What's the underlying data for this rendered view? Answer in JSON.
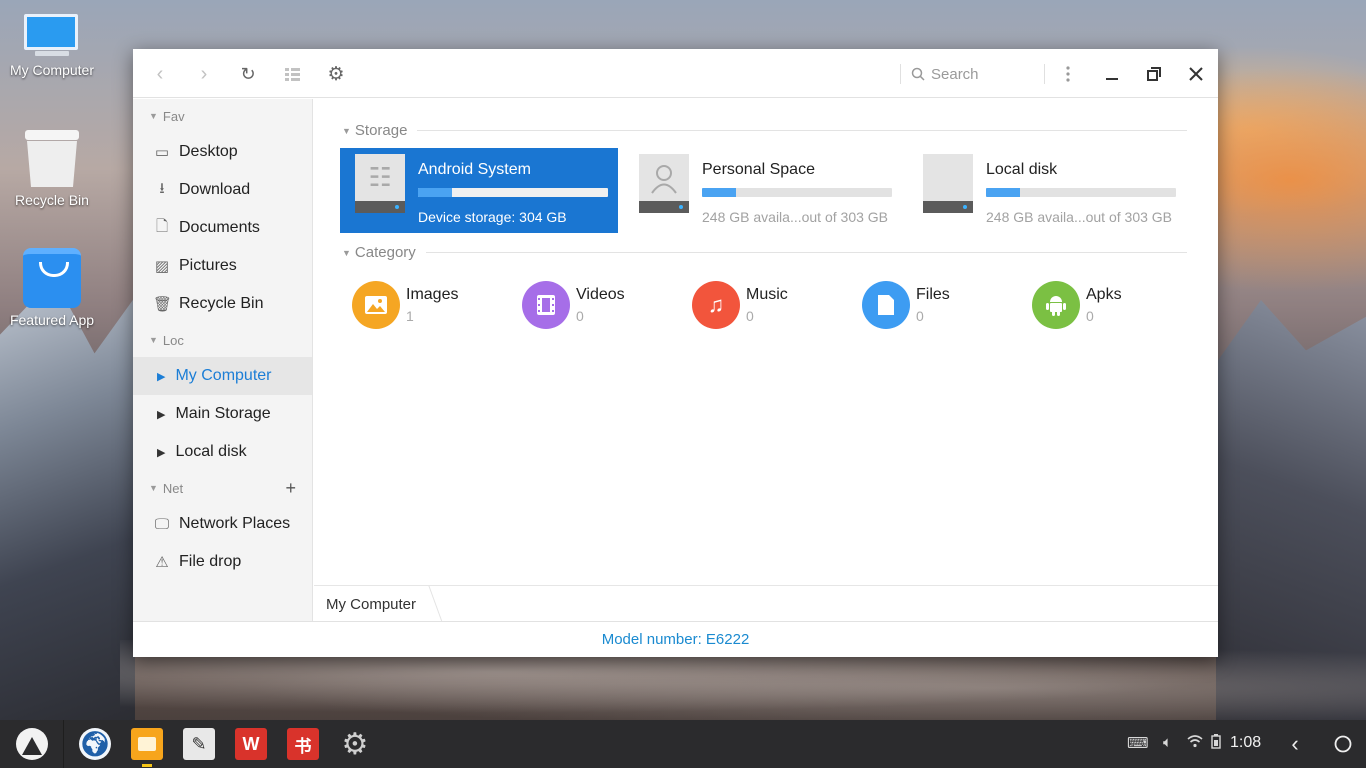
{
  "desktop": {
    "icons": [
      {
        "label": "My Computer"
      },
      {
        "label": "Recycle Bin"
      },
      {
        "label": "Featured App"
      }
    ]
  },
  "window": {
    "toolbar": {
      "back_icon": "chevron-left-icon",
      "forward_icon": "chevron-right-icon",
      "refresh_icon": "refresh-icon",
      "view_icon": "grid-view-icon",
      "settings_icon": "gear-icon",
      "search_placeholder": "Search",
      "more_icon": "more-vertical-icon",
      "minimize_icon": "minimize-icon",
      "maximize_icon": "maximize-icon",
      "close_icon": "close-icon"
    },
    "sidebar": {
      "fav_label": "Fav",
      "fav_items": [
        {
          "label": "Desktop",
          "icon": "desktop-icon"
        },
        {
          "label": "Download",
          "icon": "download-icon"
        },
        {
          "label": "Documents",
          "icon": "document-icon"
        },
        {
          "label": "Pictures",
          "icon": "picture-icon"
        },
        {
          "label": "Recycle Bin",
          "icon": "trash-icon"
        }
      ],
      "loc_label": "Loc",
      "loc_items": [
        {
          "label": "My Computer",
          "active": true
        },
        {
          "label": "Main Storage",
          "active": false
        },
        {
          "label": "Local disk",
          "active": false
        }
      ],
      "net_label": "Net",
      "net_add": "+",
      "net_items": [
        {
          "label": "Network Places",
          "icon": "network-icon"
        },
        {
          "label": "File drop",
          "icon": "file-drop-icon"
        }
      ]
    },
    "main": {
      "storage_label": "Storage",
      "storage": [
        {
          "name": "Android System",
          "detail": "Device storage: 304 GB",
          "fill": 0.18,
          "icon": "android-icon",
          "selected": true
        },
        {
          "name": "Personal Space",
          "detail": "248 GB availa...out of 303 GB",
          "fill": 0.18,
          "icon": "user-icon",
          "selected": false
        },
        {
          "name": "Local disk",
          "detail": "248 GB availa...out of 303 GB",
          "fill": 0.18,
          "icon": "disk-icon",
          "selected": false
        }
      ],
      "category_label": "Category",
      "categories": [
        {
          "name": "Images",
          "count": "1",
          "color": "#f5a623",
          "icon": "image-icon"
        },
        {
          "name": "Videos",
          "count": "0",
          "color": "#a66ee8",
          "icon": "video-icon"
        },
        {
          "name": "Music",
          "count": "0",
          "color": "#f2553c",
          "icon": "music-icon"
        },
        {
          "name": "Files",
          "count": "0",
          "color": "#3d9cf2",
          "icon": "file-icon"
        },
        {
          "name": "Apks",
          "count": "0",
          "color": "#7bc043",
          "icon": "android-icon"
        }
      ]
    },
    "path": {
      "crumb": "My Computer"
    },
    "status": {
      "text": "Model number: E6222"
    }
  },
  "taskbar": {
    "apps": [
      {
        "name": "browser",
        "icon": "globe-icon",
        "color": "#1f5fa8"
      },
      {
        "name": "file-manager",
        "icon": "folder-icon",
        "color": "#f7a51c",
        "running": true
      },
      {
        "name": "notes",
        "icon": "pen-icon",
        "color": "#e8e8e8"
      },
      {
        "name": "wps",
        "icon": "wps-icon",
        "color": "#d9332b",
        "glyph": "W"
      },
      {
        "name": "reader",
        "icon": "reader-icon",
        "color": "#d9332b",
        "glyph": "书"
      },
      {
        "name": "settings",
        "icon": "gear-icon",
        "color": "#3a3a3a"
      }
    ],
    "clock": "1:08",
    "accent": "#1a76d2"
  }
}
